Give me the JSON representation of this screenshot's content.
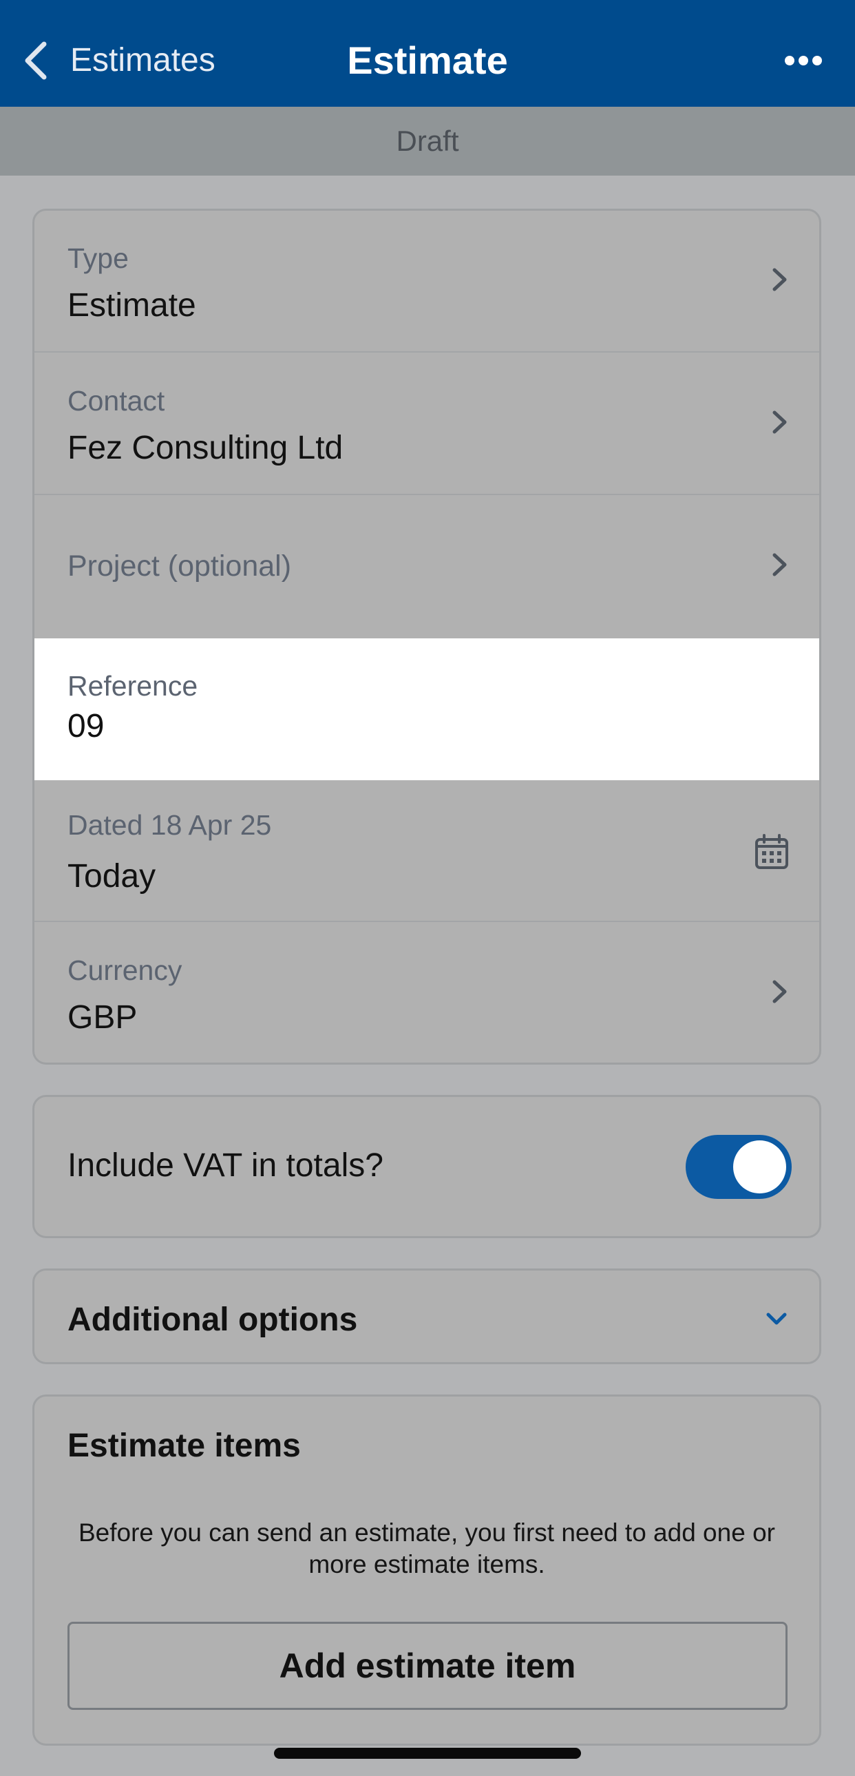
{
  "nav": {
    "back_label": "Estimates",
    "title": "Estimate",
    "more_icon": "ellipsis-icon",
    "back_icon": "chevron-left-icon"
  },
  "status": "Draft",
  "details": {
    "type": {
      "label": "Type",
      "value": "Estimate"
    },
    "contact": {
      "label": "Contact",
      "value": "Fez Consulting Ltd"
    },
    "project": {
      "label": "Project (optional)"
    },
    "reference": {
      "label": "Reference",
      "value": "09"
    },
    "dated": {
      "label": "Dated 18 Apr 25",
      "value": "Today"
    },
    "currency": {
      "label": "Currency",
      "value": "GBP"
    }
  },
  "vat": {
    "label": "Include VAT in totals?",
    "enabled": true
  },
  "additional_options": {
    "label": "Additional options"
  },
  "items": {
    "title": "Estimate items",
    "info": "Before you can send an estimate, you first need to add one or more estimate items.",
    "add_button": "Add estimate item"
  },
  "colors": {
    "nav_bg": "#004b8d",
    "accent": "#0c5aa3",
    "status_bg": "#909597"
  }
}
